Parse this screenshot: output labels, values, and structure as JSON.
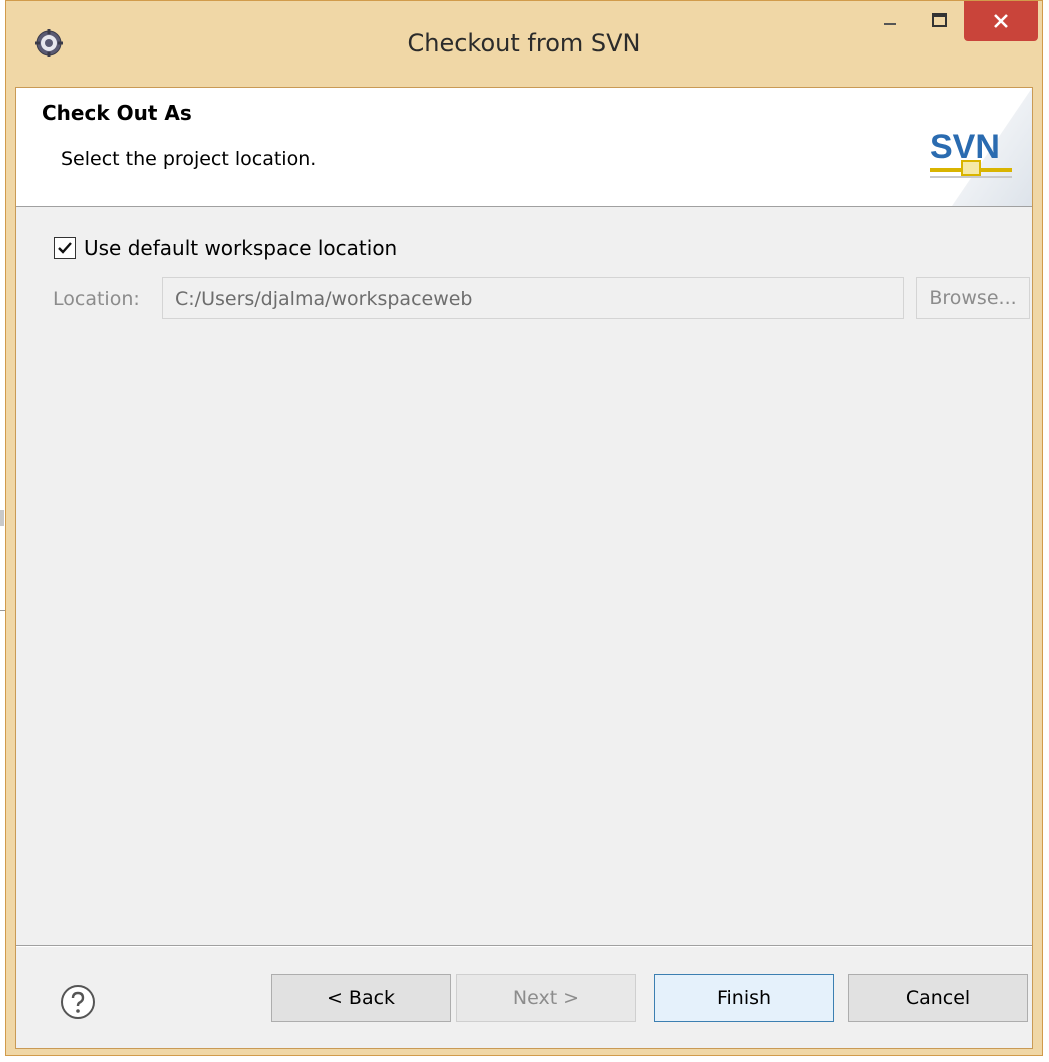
{
  "window": {
    "title": "Checkout from SVN",
    "controls": {
      "minimize_icon": "minimize-icon",
      "maximize_icon": "maximize-icon",
      "close_icon": "close-icon"
    }
  },
  "header": {
    "title": "Check Out As",
    "description": "Select the project location.",
    "logo_text": "SVN"
  },
  "options": {
    "use_default_label": "Use default workspace location",
    "use_default_checked": true
  },
  "location": {
    "label": "Location:",
    "value": "C:/Users/djalma/workspaceweb",
    "browse_label": "Browse..."
  },
  "buttons": {
    "back": "< Back",
    "next": "Next >",
    "finish": "Finish",
    "cancel": "Cancel"
  },
  "colors": {
    "titlebar": "#f0d7a6",
    "close_button": "#c9443a",
    "finish_border": "#3c7fb1"
  }
}
